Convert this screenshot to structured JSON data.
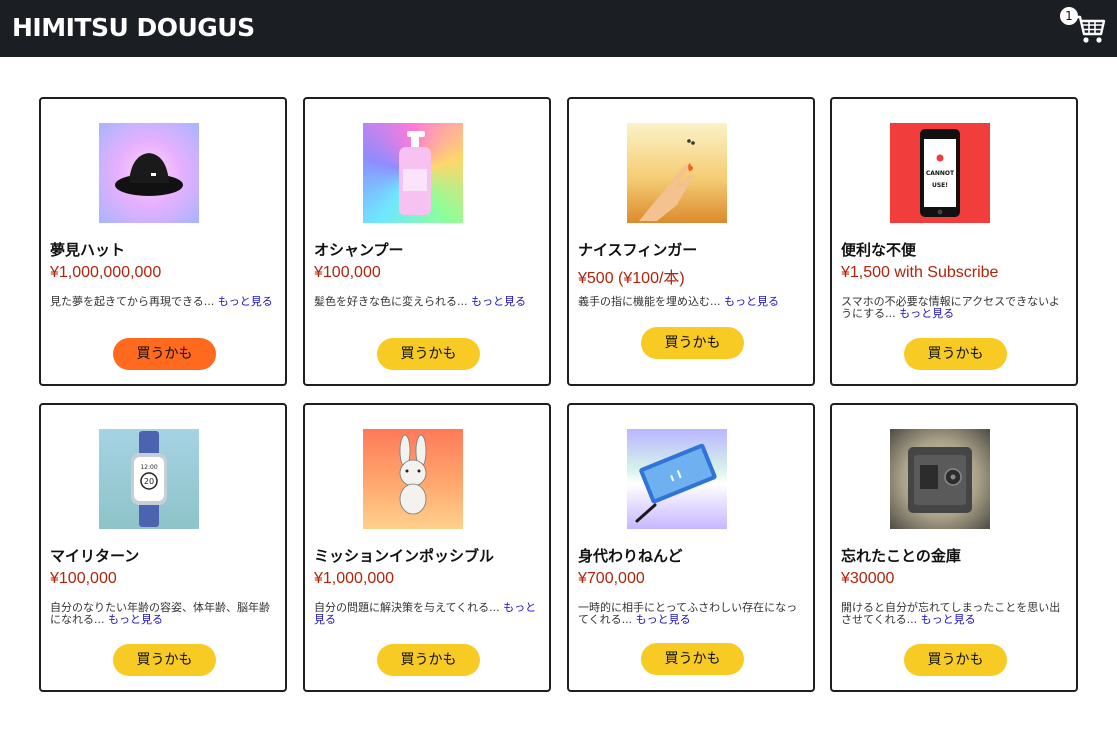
{
  "header": {
    "brand": "HIMITSU DOUGUS",
    "cart_count": "1"
  },
  "colors": {
    "header_bg": "#1b1f24",
    "price": "#b3230a",
    "link": "#1a12c8",
    "buy_button": "#f8cb24",
    "buy_button_active": "#ff6a1e"
  },
  "products": [
    {
      "name": "夢見ハット",
      "price": "¥1,000,000,000",
      "desc": "見た夢を起きてから再現できる...",
      "more": "もっと見る",
      "buy": "買うかも",
      "image": "black-bucket-hat"
    },
    {
      "name": "オシャンプー",
      "price": "¥100,000",
      "desc": "髪色を好きな色に変えられる...",
      "more": "もっと見る",
      "buy": "買うかも",
      "image": "rainbow-shampoo-bottle"
    },
    {
      "name": "ナイスフィンガー",
      "price": "¥500 (¥100/本)",
      "desc": "義手の指に機能を埋め込む...",
      "more": "もっと見る",
      "buy": "買うかも",
      "image": "hand-finger"
    },
    {
      "name": "便利な不便",
      "price": "¥1,500 with Subscribe",
      "desc": "スマホの不必要な情報にアクセスできないようにする...",
      "more": "もっと見る",
      "buy": "買うかも",
      "image": "phone-cannot-use"
    },
    {
      "name": "マイリターン",
      "price": "¥100,000",
      "desc": "自分のなりたい年齢の容姿、体年齢、脳年齢になれる...",
      "more": "もっと見る",
      "buy": "買うかも",
      "image": "smartwatch"
    },
    {
      "name": "ミッションインポッシブル",
      "price": "¥1,000,000",
      "desc": "自分の問題に解決策を与えてくれる...",
      "more": "もっと見る",
      "buy": "買うかも",
      "image": "bunny-plush"
    },
    {
      "name": "身代わりねんど",
      "price": "¥700,000",
      "desc": "一時的に相手にとってふさわしい存在になってくれる...",
      "more": "もっと見る",
      "buy": "買うかも",
      "image": "clay-tablet-pen"
    },
    {
      "name": "忘れたことの金庫",
      "price": "¥30000",
      "desc": "開けると自分が忘れてしまったことを思い出させてくれる...",
      "more": "もっと見る",
      "buy": "買うかも",
      "image": "safe"
    }
  ],
  "phone_image_text": [
    "CANNOT",
    "USE!"
  ],
  "watch_image_text": [
    "12:00",
    "20"
  ]
}
